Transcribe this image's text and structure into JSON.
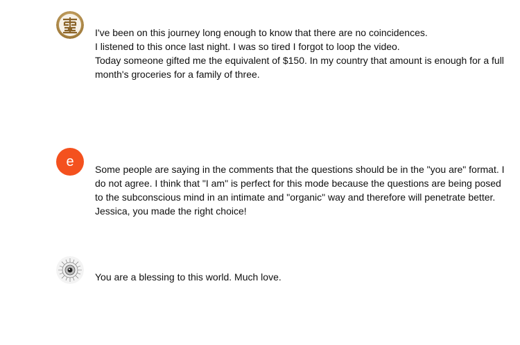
{
  "comments": [
    {
      "avatar": {
        "icon": "gold-shou-symbol-icon"
      },
      "lines": [
        "I've been on this journey long enough to know that there are no coincidences.",
        "I listened to this once last night. I was so tired I forgot to loop the video.",
        "Today someone gifted me the equivalent of  $150. In my country that amount is enough for a full",
        "month's groceries for a family of three."
      ]
    },
    {
      "avatar": {
        "letter": "e",
        "color": "#f4511e"
      },
      "lines": [
        "Some people are saying in the comments that the questions should be in the \"you are\" format. I",
        "do not agree. I think that \"I am\" is perfect for this mode because the questions are being posed",
        "to the subconscious mind in an intimate and \"organic\" way and therefore will penetrate better.",
        "Jessica, you made the right choice!"
      ]
    },
    {
      "avatar": {
        "icon": "sketch-eye-icon"
      },
      "lines": [
        "You are a blessing to this world. Much love."
      ]
    }
  ]
}
